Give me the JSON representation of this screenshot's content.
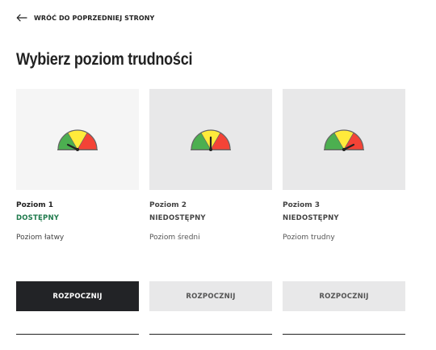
{
  "nav": {
    "back_label": "WRÓĆ DO POPRZEDNIEJ STRONY"
  },
  "page": {
    "title": "Wybierz poziom trudności"
  },
  "colors": {
    "available": "#1f7a4c",
    "unavailable": "#444444",
    "primary_button": "#222326",
    "disabled_button": "#e8e8e9"
  },
  "levels": [
    {
      "name": "Poziom 1",
      "status": "DOSTĘPNY",
      "description": "Poziom łatwy",
      "button": "ROZPOCZNIJ",
      "gauge": "low"
    },
    {
      "name": "Poziom 2",
      "status": "NIEDOSTĘPNY",
      "description": "Poziom średni",
      "button": "ROZPOCZNIJ",
      "gauge": "medium"
    },
    {
      "name": "Poziom 3",
      "status": "NIEDOSTĘPNY",
      "description": "Poziom trudny",
      "button": "ROZPOCZNIJ",
      "gauge": "high"
    }
  ]
}
